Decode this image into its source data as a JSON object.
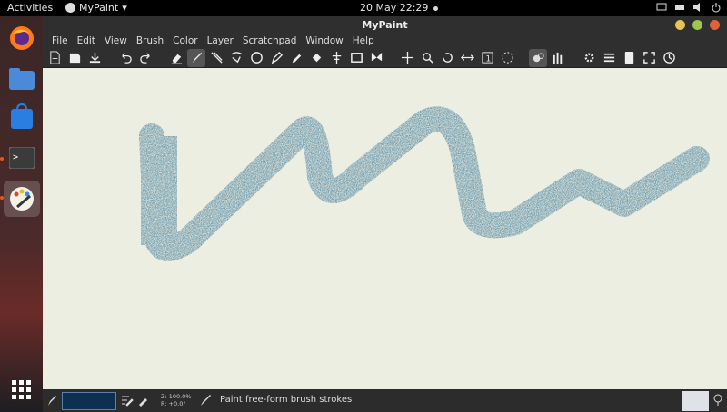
{
  "topbar": {
    "activities": "Activities",
    "app_name": "MyPaint",
    "clock": "20 May  22:29"
  },
  "window": {
    "title": "MyPaint"
  },
  "menu": [
    "File",
    "Edit",
    "View",
    "Brush",
    "Color",
    "Layer",
    "Scratchpad",
    "Window",
    "Help"
  ],
  "status": {
    "zoom": "Z: 100.0%",
    "rotation": "R: +0.0°",
    "message": "Paint free-form brush strokes"
  },
  "colors": {
    "stroke": "#4f86a0",
    "current_color": "#0d2f52",
    "canvas": "#edeee2"
  },
  "toolbar_icons": [
    "new-icon",
    "open-icon",
    "save-icon",
    "undo-icon",
    "redo-icon",
    "eraser-icon",
    "brush-icon",
    "inking-icon",
    "lasso-icon",
    "ellipse-icon",
    "pen-icon",
    "color-picker-icon",
    "fill-icon",
    "symmetry-icon",
    "frame-icon",
    "butterfly-icon",
    "move-icon",
    "zoom-icon",
    "rotate-icon",
    "mirror-icon",
    "one-to-one-icon",
    "fit-icon",
    "layers-icon",
    "brushes-icon",
    "settings-icon",
    "menu-icon",
    "scratchpad-icon",
    "fullscreen-icon",
    "history-icon"
  ]
}
